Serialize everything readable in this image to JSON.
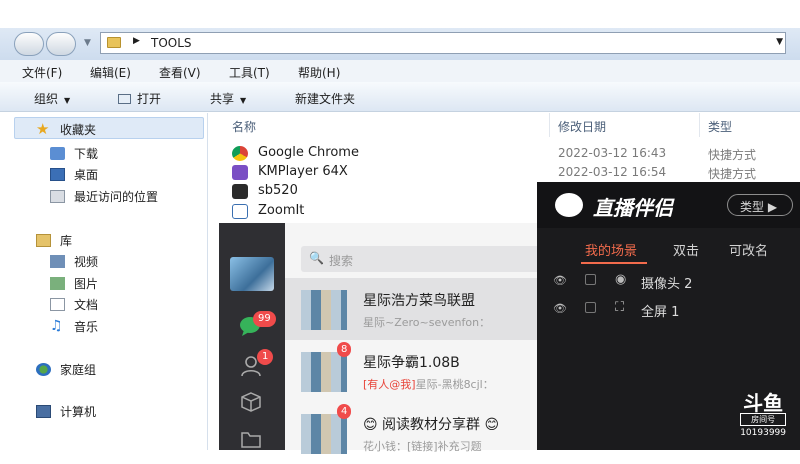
{
  "explorer": {
    "address": {
      "crumb": "TOOLS"
    },
    "menu": [
      "文件(F)",
      "编辑(E)",
      "查看(V)",
      "工具(T)",
      "帮助(H)"
    ],
    "toolbar": {
      "organize": "组织",
      "open": "打开",
      "share": "共享",
      "new_folder": "新建文件夹"
    },
    "nav": {
      "favorites": "收藏夹",
      "downloads": "下载",
      "desktop": "桌面",
      "recent": "最近访问的位置",
      "libraries": "库",
      "videos": "视频",
      "pictures": "图片",
      "documents": "文档",
      "music": "音乐",
      "homegroup": "家庭组",
      "computer": "计算机"
    },
    "columns": {
      "name": "名称",
      "modified": "修改日期",
      "type": "类型"
    },
    "files": [
      {
        "name": "Google Chrome",
        "modified": "2022-03-12 16:43",
        "type": "快捷方式",
        "icon": "chrome-icon"
      },
      {
        "name": "KMPlayer 64X",
        "modified": "2022-03-12 16:54",
        "type": "快捷方式",
        "icon": "kmplayer-icon"
      },
      {
        "name": "sb520",
        "modified": "",
        "type": "",
        "icon": "sb520-icon"
      },
      {
        "name": "ZoomIt",
        "modified": "",
        "type": "",
        "icon": "zoomit-icon"
      }
    ]
  },
  "qq": {
    "search_placeholder": "搜索",
    "badges": {
      "messages": "99",
      "contacts": "1"
    },
    "conversations": [
      {
        "name": "星际浩方菜鸟联盟",
        "preview": "星际~Zero~sevenfon：",
        "badge": "",
        "mention": ""
      },
      {
        "name": "星际争霸1.08B",
        "preview": "星际-黑桃8cjl：",
        "badge": "8",
        "mention": "[有人@我]"
      },
      {
        "name": "阅读教材分享群",
        "preview": "花小钱：[链接]补充习题",
        "badge": "4",
        "mention": ""
      }
    ]
  },
  "zhibo": {
    "title": "直播伴侣",
    "type_button": "类型",
    "tabs": [
      "我的场景",
      "双击",
      "可改名"
    ],
    "sources": [
      {
        "name": "摄像头 2",
        "kind_icon": "camera-icon"
      },
      {
        "name": "全屏 1",
        "kind_icon": "fullscreen-icon"
      }
    ],
    "watermark": {
      "brand": "斗鱼",
      "label": "房间号",
      "room": "10193999"
    }
  },
  "colors": {
    "qq_badge": "#f04b4b",
    "zhibo_accent": "#f26b4c",
    "explorer_bar": "#dfe9f5"
  }
}
